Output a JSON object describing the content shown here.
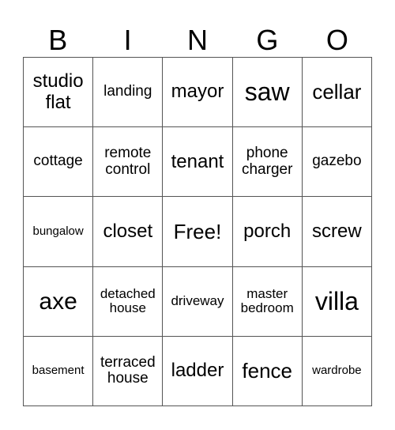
{
  "header": [
    "B",
    "I",
    "N",
    "G",
    "O"
  ],
  "cells": [
    "studio flat",
    "landing",
    "mayor",
    "saw",
    "cellar",
    "cottage",
    "remote control",
    "tenant",
    "phone charger",
    "gazebo",
    "bungalow",
    "closet",
    "Free!",
    "porch",
    "screw",
    "axe",
    "detached house",
    "driveway",
    "master bedroom",
    "villa",
    "basement",
    "terraced house",
    "ladder",
    "fence",
    "wardrobe"
  ]
}
